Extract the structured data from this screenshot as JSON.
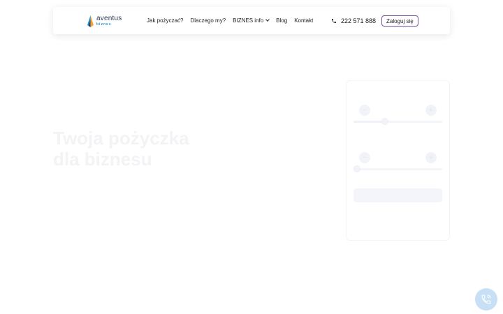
{
  "logo": {
    "name": "aventus",
    "sub": "biznes"
  },
  "nav": {
    "items": [
      "Jak pożyczać?",
      "Dlaczego my?",
      "BIZNES info",
      "Blog",
      "Kontakt"
    ]
  },
  "phone": "222 571 888",
  "login_label": "Zaloguj się",
  "hero": {
    "title_line1": "Twoja pożyczka",
    "title_line2": "dla biznesu"
  },
  "colors": {
    "accent_border": "#7a4fa3",
    "logo_blue": "#1f8fd6",
    "fab": "#c7e0f6"
  },
  "icons": {
    "phone": "phone-icon",
    "fab": "phone-call-icon",
    "dropdown": "chevron-down-icon"
  }
}
